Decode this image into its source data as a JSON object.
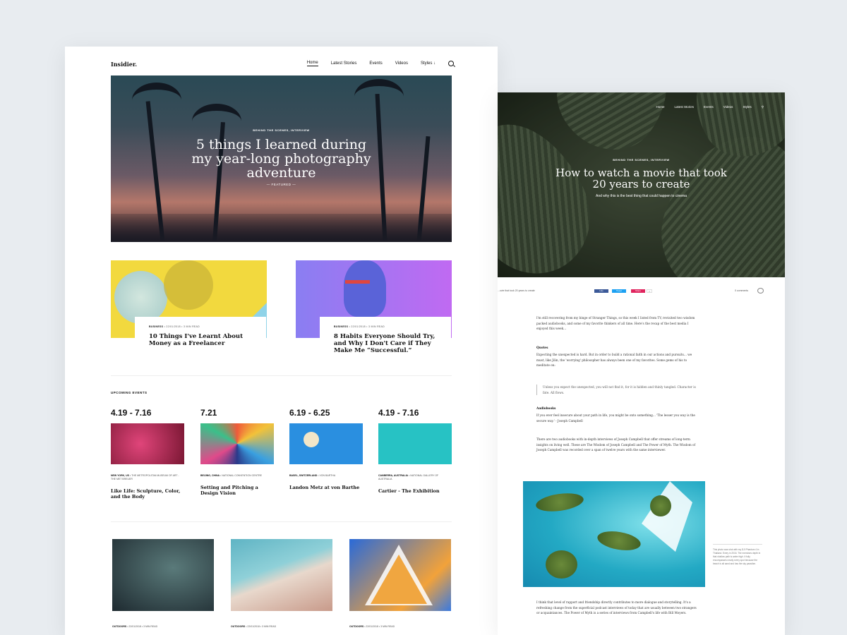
{
  "left": {
    "logo": "Insidier.",
    "nav": [
      "Home",
      "Latest Stories",
      "Events",
      "Videos",
      "Styles ↓"
    ],
    "hero": {
      "kicker": "BEHIND THE SCENES, INTERVIEW",
      "title": "5 things I learned during my year-long photography adventure",
      "featured": "— FEATURED —"
    },
    "cards": [
      {
        "category": "BUSINESS",
        "meta": "• 22/01/2018 • 3 MIN READ",
        "title": "10 Things I've Learnt About Money as a Freelancer"
      },
      {
        "category": "BUSINESS",
        "meta": "• 22/01/2018 • 3 MIN READ",
        "title": "8 Habits Everyone Should Try, and Why I Don't Care if They Make Me “Successful.”"
      }
    ],
    "events_title": "UPCOMING EVENTS",
    "events": [
      {
        "date": "4.19 - 7.16",
        "location": "NEW YORK, US",
        "venue": "• THE METROPOLITAN MUSEUM OF ART - THE MET BREUER",
        "title": "Like Life: Sculpture, Color, and the Body"
      },
      {
        "date": "7.21",
        "location": "BEIJING, CHINA",
        "venue": "• NATIONAL CONVENTION CENTRE",
        "title": "Setting and Pitching a Design Vision"
      },
      {
        "date": "6.19 - 6.25",
        "location": "BASEL, SWITZERLAND",
        "venue": "• VON BARTHA",
        "title": "Landon Metz at von Barthe"
      },
      {
        "date": "4.19 - 7.16",
        "location": "CANBERRA, AUSTRALIA",
        "venue": "• NATIONAL GALLERY OF AUSTRALIA",
        "title": "Cartier - The Exhibition"
      }
    ],
    "thumbs": [
      {
        "category": "OUTDOORS",
        "meta": "• 22/01/2018 • 3 MIN READ"
      },
      {
        "category": "OUTDOORS",
        "meta": "• 22/01/2018 • 3 MIN READ"
      },
      {
        "category": "OUTDOORS",
        "meta": "• 22/01/2018 • 3 MIN READ"
      }
    ]
  },
  "right": {
    "nav": [
      "Home",
      "Latest Stories",
      "Events",
      "Videos",
      "Styles"
    ],
    "hero": {
      "kicker": "BEHIND THE SCENES, INTERVIEW",
      "title": "How to watch a movie that took 20 years to create",
      "subtitle": "And why this is the best thing that could happen to cinema"
    },
    "share_title": "...ovie that took 20 years to create",
    "share_buttons": [
      "Like",
      "Tweet",
      "Share",
      "0"
    ],
    "comments": "0 comments",
    "p1": "I'm still recovering from my binge of Stranger Things, so this week I listed from TV, revisited two wisdom packed audiobooks, and some of my favorite thinkers of all time. Here's the recap of the best media I enjoyed this week...",
    "h_quotes": "Quotes",
    "p2": "Expecting the unexpected is hard. But in order to build a rational faith in our actions and pursuits... we must, like Jilin, the 'worrying' philosopher has always been one of my favorites. Some gems of his to meditate on:",
    "quote": "Unless you expect the unexpected, you will not find it, for it is hidden and thinly tangled. Character is fate. All flows.",
    "h_audio": "Audiobooks",
    "p3": "If you ever feel insecure about your path in life, you might be onto something... 'The lesser you way is the secure way.' - Joseph Campbell",
    "p4": "There are two audiobooks with in-depth interviews of Joseph Campbell that offer streams of long-term insights on living well. These are The Wisdom of Joseph Campbell and The Power of Myth. The Wisdom of Joseph Campbell was recorded over a span of twelve years with the same interviewer.",
    "caption": "This photo was shot with my DJI Phantom 4 in Thailand. Every in 2016. The exercises depth in that shallow path is water high. It fully encompasses nearly every spot because the beach is all sand and has the sky paradise.",
    "p5": "I think that level of rapport and friendship directly contributes to more dialogue and storytelling. It's a refreshing change from the superficial podcast interviews of today that are usually between two strangers or acquaintances. The Power of Myth is a series of interviews from Campbell's life with Bill Moyers."
  }
}
